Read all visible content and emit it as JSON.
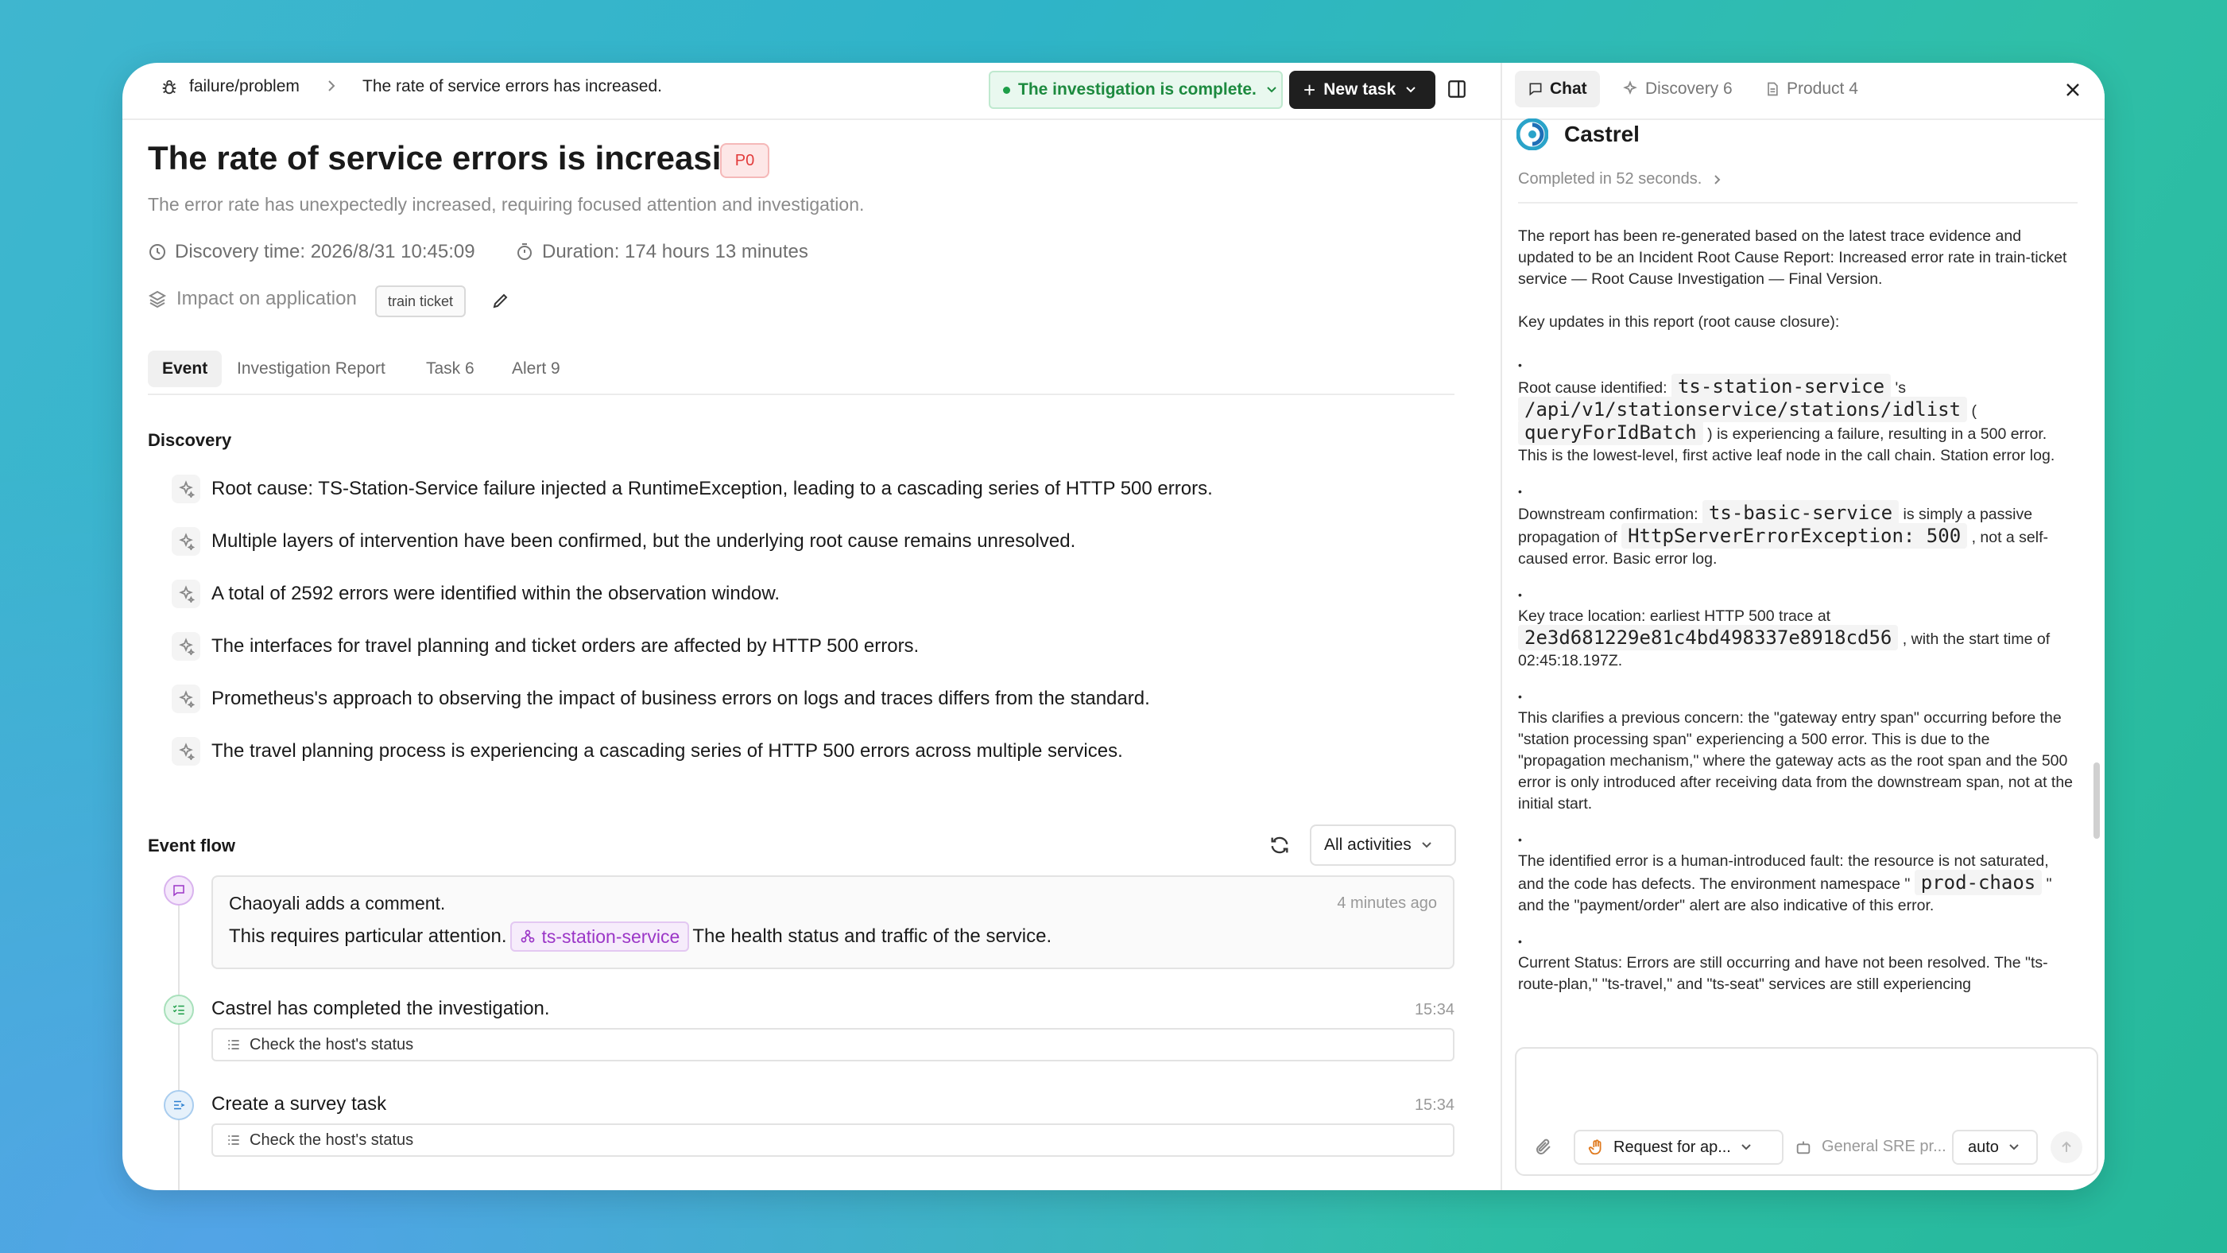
{
  "breadcrumb": {
    "root": "failure/problem",
    "current": "The rate of service errors has increased."
  },
  "toolbar": {
    "status": "The investigation is complete.",
    "new_task": "New task"
  },
  "incident": {
    "title": "The rate of service errors is increasing.",
    "priority": "P0",
    "description": "The error rate has unexpectedly increased, requiring focused attention and investigation.",
    "discovery_time": "Discovery time: 2026/8/31 10:45:09",
    "duration": "Duration: 174 hours 13 minutes",
    "impact_label": "Impact on application",
    "impact_tag": "train ticket"
  },
  "tabs": [
    "Event",
    "Investigation Report",
    "Task 6",
    "Alert 9"
  ],
  "discovery": {
    "label": "Discovery",
    "items": [
      "Root cause: TS-Station-Service failure injected a RuntimeException, leading to a cascading series of HTTP 500 errors.",
      "Multiple layers of intervention have been confirmed, but the underlying root cause remains unresolved.",
      "A total of 2592 errors were identified within the observation window.",
      "The interfaces for travel planning and ticket orders are affected by HTTP 500 errors.",
      "Prometheus's approach to observing the impact of business errors on logs and traces differs from the standard.",
      "The travel planning process is experiencing a cascading series of HTTP 500 errors across multiple services."
    ]
  },
  "event_flow": {
    "label": "Event flow",
    "filter": "All activities",
    "comment": {
      "author": "Chaoyali adds a comment.",
      "time": "4 minutes ago",
      "text_before": "This requires particular attention.",
      "service": "ts-station-service",
      "text_after": "The health status and traffic of the service."
    },
    "events": [
      {
        "title": "Castrel has completed the investigation.",
        "time": "15:34",
        "task": "Check the host's status"
      },
      {
        "title": "Create a survey task",
        "time": "15:34",
        "task": "Check the host's status"
      }
    ]
  },
  "right_panel": {
    "tabs": {
      "chat": "Chat",
      "discovery": "Discovery 6",
      "product": "Product 4"
    },
    "brand": "Castrel",
    "completed": "Completed in 52 seconds.",
    "report": {
      "intro": "The report has been re-generated based on the latest trace evidence and updated to be an Incident Root Cause Report: Increased error rate in train-ticket service — Root Cause Investigation — Final Version.",
      "key_updates": "Key updates in this report (root cause closure):",
      "b1_a": "Root cause identified:",
      "b1_code1": "ts-station-service",
      "b1_b": "'s",
      "b1_code2": "/api/v1/stationservice/stations/idlist",
      "b1_c": "(",
      "b1_code3": "queryForIdBatch",
      "b1_d": ") is experiencing a failure, resulting in a 500 error. This is the lowest-level, first active leaf node in the call chain. Station error log.",
      "b2_a": "Downstream confirmation:",
      "b2_code1": "ts-basic-service",
      "b2_b": "is simply a passive propagation of",
      "b2_code2": "HttpServerErrorException: 500",
      "b2_c": ", not a self-caused error. Basic error log.",
      "b3_a": "Key trace location: earliest HTTP 500 trace at",
      "b3_code": "2e3d681229e81c4bd498337e8918cd56",
      "b3_b": ", with the start time of 02:45:18.197Z.",
      "b4": "This clarifies a previous concern: the \"gateway entry span\" occurring before the \"station processing span\" experiencing a 500 error. This is due to the \"propagation mechanism,\" where the gateway acts as the root span and the 500 error is only introduced after receiving data from the downstream span, not at the initial start.",
      "b5_a": "The identified error is a human-introduced fault: the resource is not saturated, and the code has defects. The environment namespace \"",
      "b5_code": "prod-chaos",
      "b5_b": "\" and the \"payment/order\" alert are also indicative of this error.",
      "b6": "Current Status: Errors are still occurring and have not been resolved. The \"ts-route-plan,\" \"ts-travel,\" and \"ts-seat\" services are still experiencing"
    },
    "composer": {
      "request": "Request for ap...",
      "agent": "General SRE pr...",
      "mode": "auto"
    }
  }
}
